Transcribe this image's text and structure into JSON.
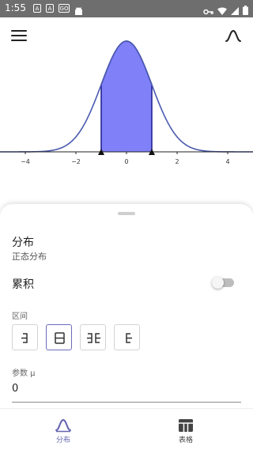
{
  "statusbar": {
    "time": "1:55",
    "notification_icons": [
      "A",
      "A",
      "GO"
    ]
  },
  "chart_data": {
    "type": "area",
    "title": "",
    "xlabel": "",
    "ylabel": "",
    "x_ticks": [
      -4,
      -2,
      0,
      2,
      4
    ],
    "x_tick_labels": [
      "−4",
      "−2",
      "0",
      "2",
      "4"
    ],
    "xlim": [
      -5,
      5
    ],
    "curve": "normal density, mean 0, sd 1",
    "shaded_interval": [
      -1,
      1
    ],
    "colors": {
      "curve": "#4a5ab0",
      "fill": "#8080f8",
      "fill_outline": "#1a1a8a"
    }
  },
  "toolbar": {
    "menu_icon": "menu-icon",
    "distribution_icon": "bell-curve-icon"
  },
  "sheet": {
    "title": "分布",
    "subtitle": "正态分布",
    "cumulative_label": "累积",
    "cumulative_on": false,
    "interval_label": "区间",
    "interval_buttons": [
      {
        "icon": "left-bound-icon",
        "selected": false
      },
      {
        "icon": "two-sided-interval-icon",
        "selected": true
      },
      {
        "icon": "outside-interval-icon",
        "selected": false
      },
      {
        "icon": "right-bound-icon",
        "selected": false
      }
    ],
    "param_label": "参数 μ",
    "param_value": "0"
  },
  "nav": {
    "items": [
      {
        "label": "分布",
        "icon": "distribution-icon",
        "active": true
      },
      {
        "label": "表格",
        "icon": "table-icon",
        "active": false
      }
    ],
    "active_color": "#6363b0",
    "inactive_color": "#444444"
  }
}
